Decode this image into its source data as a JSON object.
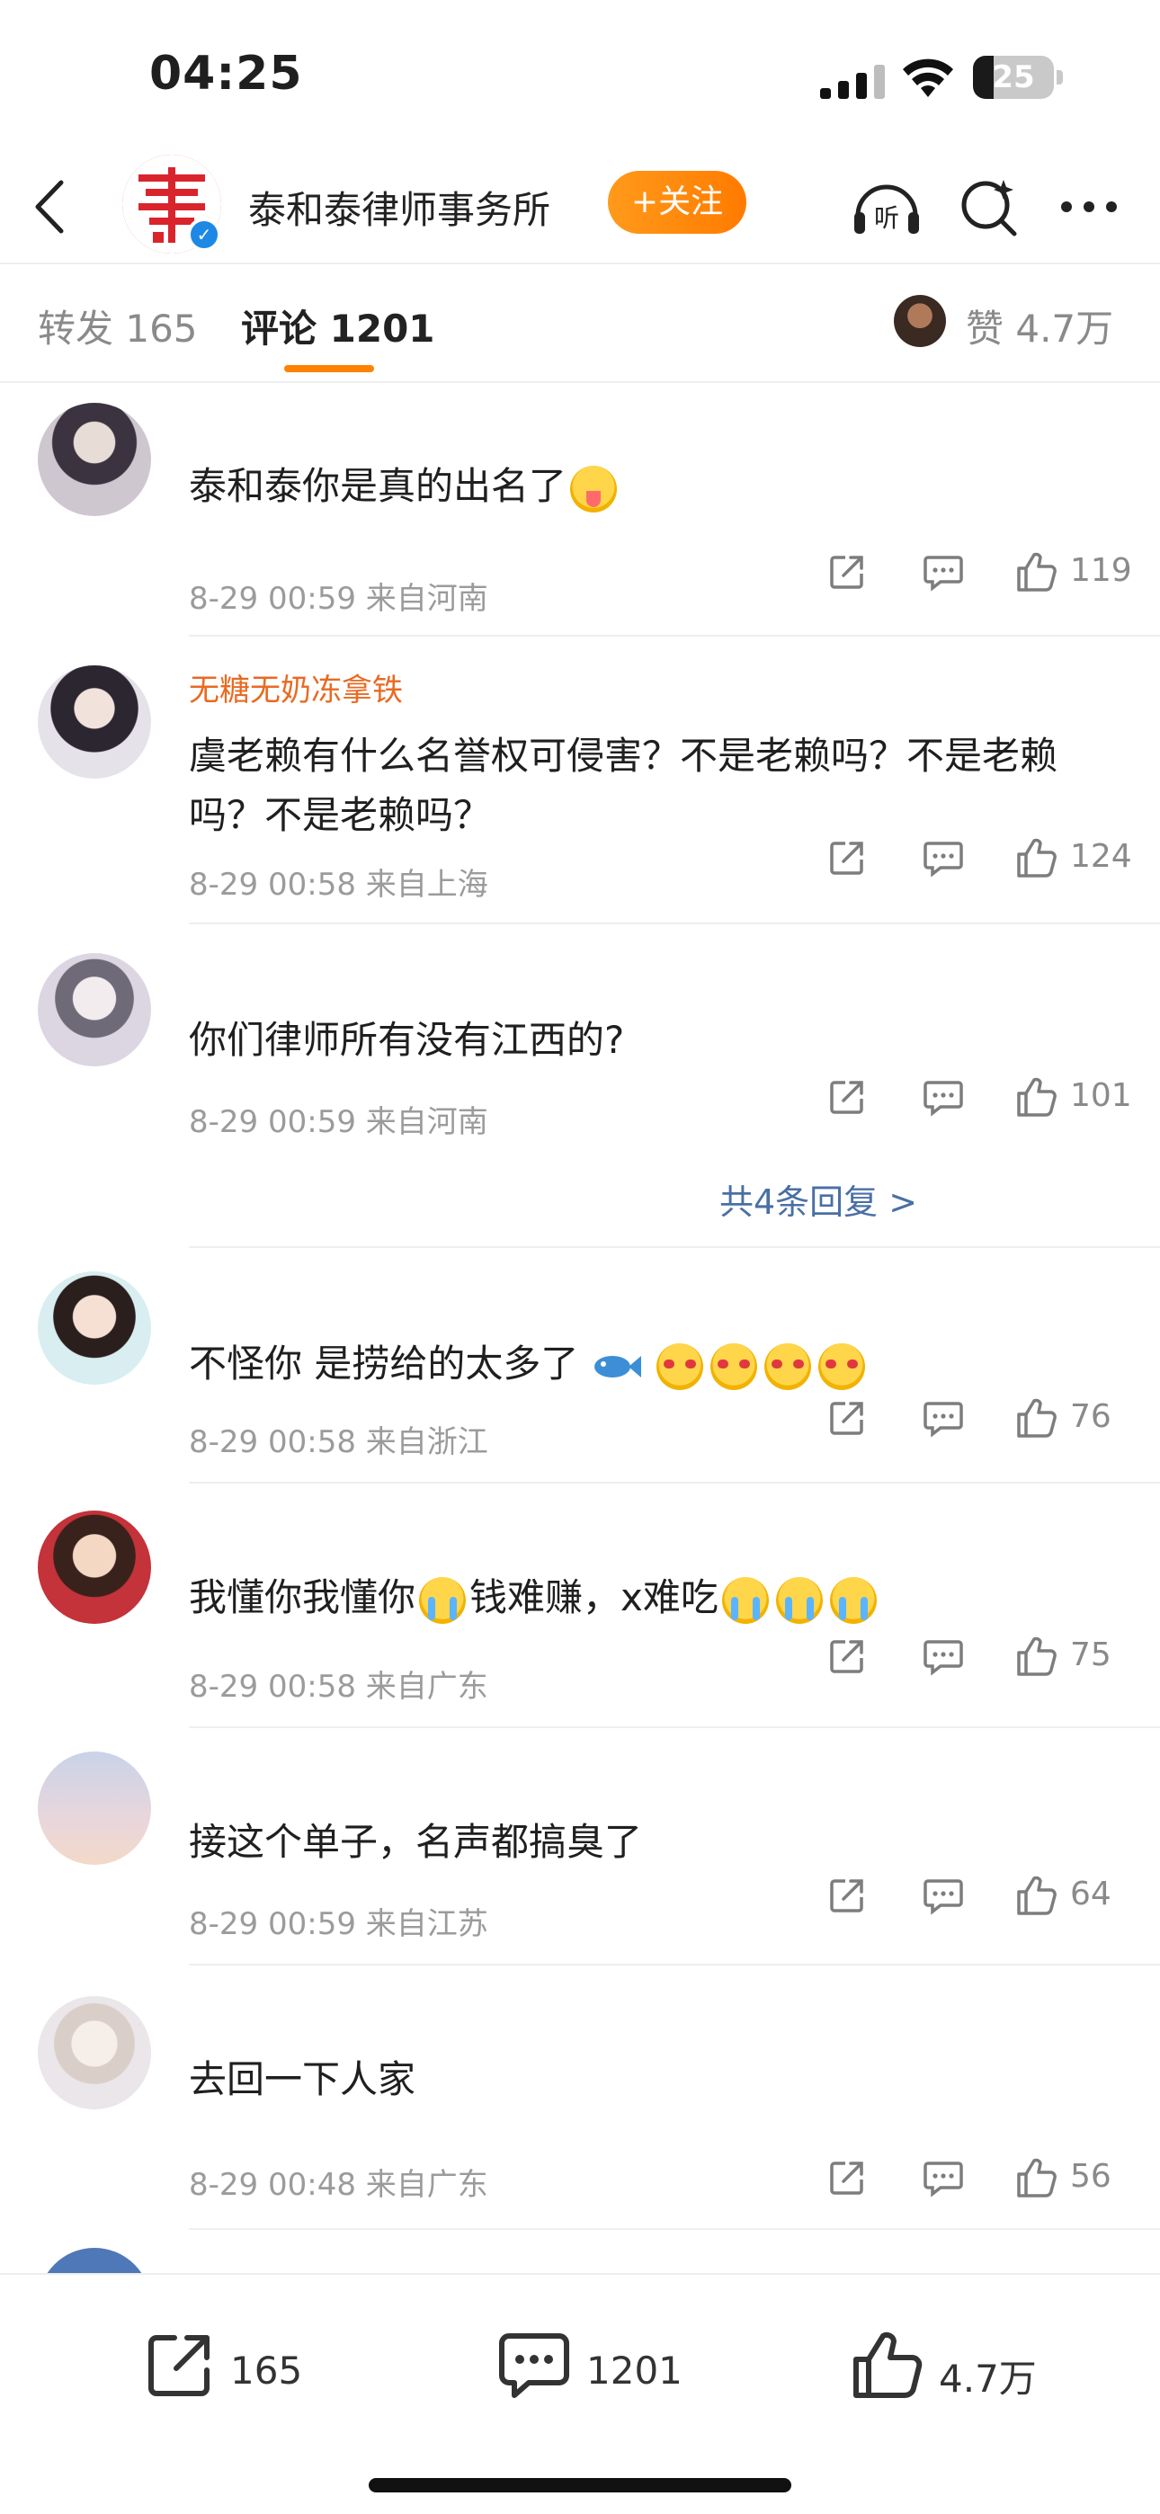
{
  "status_bar": {
    "time": "04:25",
    "battery": "25",
    "battery_fraction": 0.25
  },
  "header": {
    "account_name": "泰和泰律师事务所",
    "follow_label": "+关注",
    "icons": [
      "back-icon",
      "listen-icon",
      "star-search-icon",
      "more-icon"
    ]
  },
  "tabs": {
    "reposts_label": "转发 165",
    "comments_label": "评论 1201",
    "likes_label": "赞 4.7万"
  },
  "comments": [
    {
      "username": "",
      "text": "泰和泰你是真的出名了",
      "meta": "8-29 00:59 来自河南",
      "likes": "119"
    },
    {
      "username": "无糖无奶冻拿铁",
      "text": "虞老赖有什么名誉权可侵害？不是老赖吗？不是老赖吗？不是老赖吗？",
      "meta": "8-29 00:58 来自上海",
      "likes": "124"
    },
    {
      "username": "",
      "text": "你们律师所有没有江西的?",
      "meta": "8-29 00:59 来自河南",
      "likes": "101",
      "replies": "共4条回复 >"
    },
    {
      "username": "",
      "text": "不怪你 是捞给的太多了",
      "meta": "8-29 00:58 来自浙江",
      "likes": "76"
    },
    {
      "username": "",
      "text": "我懂你我懂你钱难赚，x难吃",
      "meta": "8-29 00:58 来自广东",
      "likes": "75"
    },
    {
      "username": "",
      "text": "接这个单子，名声都搞臭了",
      "meta": "8-29 00:59 来自江苏",
      "likes": "64"
    },
    {
      "username": "",
      "text": "去回一下人家",
      "meta": "8-29 00:48 来自广东",
      "likes": "56"
    }
  ],
  "bottom_bar": {
    "reposts": "165",
    "comments": "1201",
    "likes": "4.7万"
  },
  "colors": {
    "accent_orange": "#ff8200",
    "username_orange": "#e86a22",
    "link_blue": "#4a6fa5",
    "meta_gray": "#9b9b9b"
  }
}
